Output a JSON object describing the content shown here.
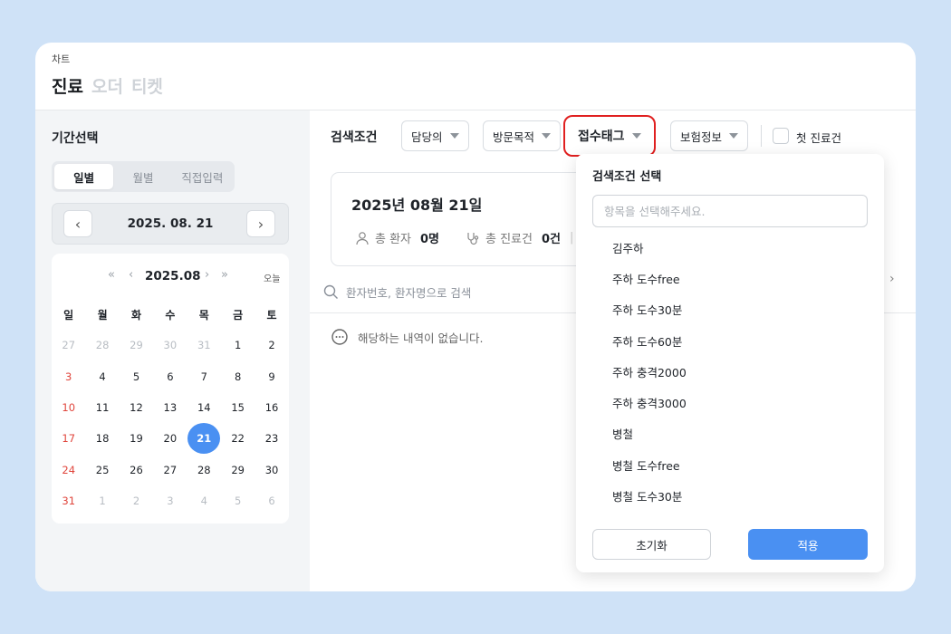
{
  "header": {
    "crumb": "차트",
    "tabs": [
      {
        "label": "진료",
        "active": true
      },
      {
        "label": "오더",
        "active": false
      },
      {
        "label": "티켓",
        "active": false
      }
    ]
  },
  "left": {
    "title": "기간선택",
    "segments": [
      "일별",
      "월별",
      "직접입력"
    ],
    "date": "2025. 08. 21",
    "calendar": {
      "month": "2025.08",
      "today_label": "오늘",
      "weekdays": [
        "일",
        "월",
        "화",
        "수",
        "목",
        "금",
        "토"
      ],
      "weeks": [
        [
          "27",
          "28",
          "29",
          "30",
          "31",
          "1",
          "2"
        ],
        [
          "3",
          "4",
          "5",
          "6",
          "7",
          "8",
          "9"
        ],
        [
          "10",
          "11",
          "12",
          "13",
          "14",
          "15",
          "16"
        ],
        [
          "17",
          "18",
          "19",
          "20",
          "21",
          "22",
          "23"
        ],
        [
          "24",
          "25",
          "26",
          "27",
          "28",
          "29",
          "30"
        ],
        [
          "31",
          "1",
          "2",
          "3",
          "4",
          "5",
          "6"
        ]
      ],
      "selected": "21"
    }
  },
  "filters": {
    "label": "검색조건",
    "buttons": [
      "담당의",
      "방문목적",
      "접수태그",
      "보험정보"
    ],
    "first_visit_label": "첫 진료건"
  },
  "summary": {
    "date": "2025년 08월 21일",
    "patients_label": "총 환자",
    "patients_value": "0명",
    "visits_label": "총 진료건",
    "visits_value": "0건"
  },
  "search": {
    "placeholder": "환자번호, 환자명으로 검색"
  },
  "empty_message": "해당하는 내역이 없습니다.",
  "dropdown": {
    "title": "검색조건 선택",
    "placeholder": "항목을 선택해주세요.",
    "items": [
      "김주하",
      "주하 도수free",
      "주하 도수30분",
      "주하 도수60분",
      "주하 충격2000",
      "주하 충격3000",
      "병철",
      "병철 도수free",
      "병철 도수30분"
    ],
    "reset_label": "초기화",
    "apply_label": "적용"
  },
  "colors": {
    "accent": "#4a90f2",
    "highlight": "#e02020",
    "sunday": "#e0453c",
    "background": "#cfe2f7"
  }
}
